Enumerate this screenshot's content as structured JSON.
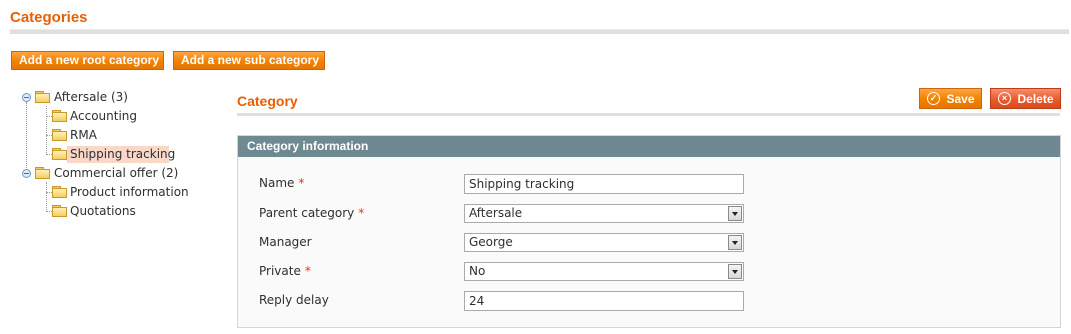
{
  "page": {
    "title": "Categories"
  },
  "toolbar": {
    "add_root_label": "Add a new root category",
    "add_sub_label": "Add a new sub category"
  },
  "tree": {
    "nodes": [
      {
        "label": "Aftersale (3)",
        "level": 0,
        "expanded": true,
        "icon": "folder-icon"
      },
      {
        "label": "Accounting",
        "level": 1,
        "icon": "folder-icon"
      },
      {
        "label": "RMA",
        "level": 1,
        "icon": "folder-icon"
      },
      {
        "label": "Shipping tracking",
        "level": 1,
        "selected": true,
        "icon": "folder-icon"
      },
      {
        "label": "Commercial offer (2)",
        "level": 0,
        "expanded": true,
        "icon": "folder-icon"
      },
      {
        "label": "Product information",
        "level": 1,
        "icon": "folder-icon"
      },
      {
        "label": "Quotations",
        "level": 1,
        "icon": "folder-icon"
      }
    ]
  },
  "category": {
    "heading": "Category",
    "save_label": "Save",
    "delete_label": "Delete",
    "save_icon": "check-circle-icon",
    "delete_icon": "x-circle-icon"
  },
  "form": {
    "section_title": "Category information",
    "fields": [
      {
        "label": "Name",
        "required": true,
        "type": "text",
        "value": "Shipping tracking"
      },
      {
        "label": "Parent category",
        "required": true,
        "type": "select",
        "value": "Aftersale"
      },
      {
        "label": "Manager",
        "required": false,
        "type": "select",
        "value": "George"
      },
      {
        "label": "Private",
        "required": true,
        "type": "select",
        "value": "No"
      },
      {
        "label": "Reply delay",
        "required": false,
        "type": "text",
        "value": "24"
      }
    ],
    "required_marker": "*"
  },
  "colors": {
    "accent": "#eb5e00",
    "button": "#f18200",
    "delete_button": "#ea5a2b",
    "section_header": "#6f8992",
    "selected_node": "#f9d7c9"
  }
}
